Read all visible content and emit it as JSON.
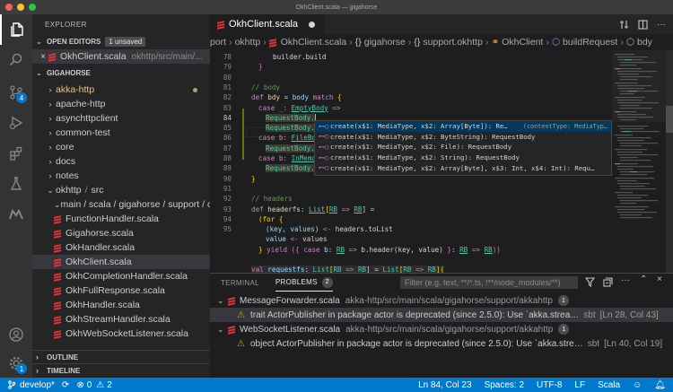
{
  "window": {
    "title": "OkhClient.scala — gigahorse",
    "traffic_colors": [
      "#ff5f57",
      "#febc2e",
      "#28c840"
    ]
  },
  "activity": {
    "scm_badge": "4",
    "settings_badge": "1"
  },
  "sidebar": {
    "title": "EXPLORER",
    "open_editors": {
      "label": "OPEN EDITORS",
      "badge": "1 unsaved",
      "file": "OkhClient.scala",
      "path": "okhttp/src/main/..."
    },
    "workspace": "GIGAHORSE",
    "tree": [
      {
        "label": "akka-http",
        "modified": true
      },
      {
        "label": "apache-http"
      },
      {
        "label": "asynchttpclient"
      },
      {
        "label": "common-test"
      },
      {
        "label": "core"
      },
      {
        "label": "docs"
      },
      {
        "label": "notes"
      }
    ],
    "okhttp_folder": {
      "label": "okhttp",
      "sep": "/",
      "sub": "src"
    },
    "main_path": "main / scala / gigahorse / support / ok...",
    "files": [
      "FunctionHandler.scala",
      "Gigahorse.scala",
      "OkHandler.scala",
      "OkhClient.scala",
      "OkhCompletionHandler.scala",
      "OkhFullResponse.scala",
      "OkhHandler.scala",
      "OkhStreamHandler.scala",
      "OkhWebSocketListener.scala"
    ],
    "outline": "OUTLINE",
    "timeline": "TIMELINE"
  },
  "editor": {
    "tab": "OkhClient.scala",
    "breadcrumb": [
      "port",
      "okhttp",
      "OkhClient.scala",
      "gigahorse",
      "support.okhttp",
      "OkhClient",
      "buildRequest",
      "bdy"
    ],
    "code": {
      "l78": "builder.build",
      "l81": "// body",
      "l82": [
        "def ",
        "bdy",
        " = ",
        "body ",
        "match",
        " {"
      ],
      "l83": [
        "case _: ",
        "EmptyBody",
        " =>"
      ],
      "req": "RequestBody.",
      "case_b": "case b: ",
      "filebo": "FileBo",
      "inmemo": "InMemo",
      "l88": "// headers",
      "l89": [
        "def ",
        "headerfs",
        ": ",
        "List",
        "[",
        "RB",
        " => ",
        "RB",
        "] ="
      ],
      "l90": "(for {",
      "l91": [
        "(key, values) ",
        "<-",
        " headers.toList"
      ],
      "l92": [
        "value ",
        "<-",
        " values"
      ],
      "l93": [
        "} ",
        "yield",
        " ({ ",
        "case ",
        "b",
        ": ",
        "RB",
        " => ",
        "b.header(key, value) ",
        "}",
        ": ",
        "RB",
        " => ",
        "RB",
        "))"
      ],
      "l95": [
        "val ",
        "requestfs",
        ": ",
        "List",
        "[",
        "RB",
        " => ",
        "RB",
        "] = ",
        "List",
        "[",
        "RB",
        " => ",
        "RB",
        "]("
      ]
    },
    "line_numbers": [
      "78",
      "79",
      "80",
      "81",
      "82",
      "83",
      "84",
      "85",
      "86",
      "87",
      "88",
      "89",
      "90",
      "91",
      "92",
      "93",
      "94",
      "95"
    ],
    "suggestions": [
      {
        "text": "create(x$1: MediaType, x$2: Array[Byte]): Re…",
        "detail": "(contentType: MediaTyp…"
      },
      {
        "text": "create(x$1: MediaType, x$2: ByteString): RequestBody",
        "detail": ""
      },
      {
        "text": "create(x$1: MediaType, x$2: File): RequestBody",
        "detail": ""
      },
      {
        "text": "create(x$1: MediaType, x$2: String): RequestBody",
        "detail": ""
      },
      {
        "text": "create(x$1: MediaType, x$2: Array[Byte], x$3: Int, x$4: Int): Requ…",
        "detail": ""
      }
    ],
    "suggest_icon": "⊷◯"
  },
  "panel": {
    "tabs": [
      "TERMINAL",
      "PROBLEMS"
    ],
    "problems_count": "2",
    "filter_placeholder": "Filter (e.g. text, **/*.ts, !**/node_modules/**)",
    "problems": [
      {
        "file": "MessageForwarder.scala",
        "path": "akka-http/src/main/scala/gigahorse/support/akkahttp",
        "count": "1",
        "message": "trait ActorPublisher in package actor is deprecated (since 2.5.0): Use `akka.strea…",
        "source": "sbt",
        "loc": "[Ln 28, Col 43]"
      },
      {
        "file": "WebSocketListener.scala",
        "path": "akka-http/src/main/scala/gigahorse/support/akkahttp",
        "count": "1",
        "message": "object ActorPublisher in package actor is deprecated (since 2.5.0): Use `akka.stre…",
        "source": "sbt",
        "loc": "[Ln 40, Col 19]"
      }
    ]
  },
  "status": {
    "branch": "develop*",
    "errors": "0",
    "warnings": "2",
    "position": "Ln 84, Col 23",
    "spaces": "Spaces: 2",
    "encoding": "UTF-8",
    "eol": "LF",
    "language": "Scala"
  }
}
